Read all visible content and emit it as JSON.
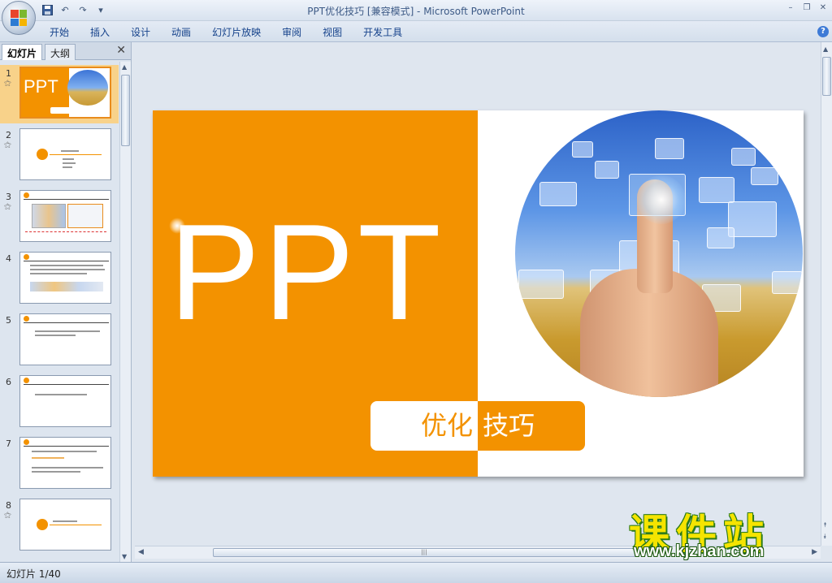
{
  "window": {
    "title": "PPT优化技巧 [兼容模式] - Microsoft PowerPoint"
  },
  "quick_access": {
    "save_icon": "save-icon",
    "undo_icon": "undo-icon",
    "redo_icon": "redo-icon"
  },
  "ribbon": {
    "tabs": [
      "开始",
      "插入",
      "设计",
      "动画",
      "幻灯片放映",
      "审阅",
      "视图",
      "开发工具"
    ],
    "help_label": "?"
  },
  "left_panel": {
    "tab_slides": "幻灯片",
    "tab_outline": "大纲",
    "close_label": "✕",
    "thumbnails": [
      {
        "num": "1",
        "has_star": true,
        "text": "PPT"
      },
      {
        "num": "2",
        "has_star": true
      },
      {
        "num": "3",
        "has_star": true
      },
      {
        "num": "4",
        "has_star": false
      },
      {
        "num": "5",
        "has_star": false
      },
      {
        "num": "6",
        "has_star": false
      },
      {
        "num": "7",
        "has_star": false
      },
      {
        "num": "8",
        "has_star": true
      }
    ],
    "star_glyph": "⚝"
  },
  "slide": {
    "big_text": "PPT",
    "caption_left": "优化",
    "caption_right": "技巧",
    "accent": "#f39200"
  },
  "status": {
    "slide_counter": "幻灯片 1/40"
  },
  "watermark": {
    "name": "课件站",
    "url": "www.kjzhan.com"
  }
}
